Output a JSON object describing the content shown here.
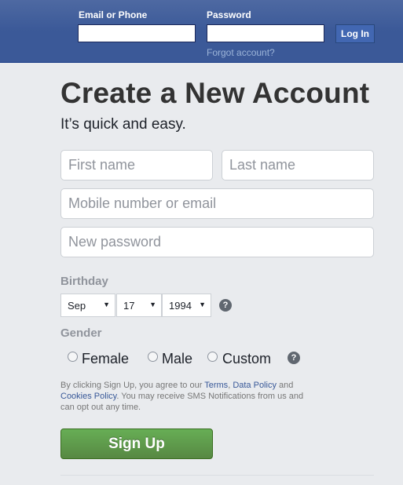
{
  "header": {
    "email_label": "Email or Phone",
    "password_label": "Password",
    "login_label": "Log In",
    "forgot_label": "Forgot account?"
  },
  "signup": {
    "title": "Create a New Account",
    "subtitle": "It’s quick and easy.",
    "first_name_placeholder": "First name",
    "last_name_placeholder": "Last name",
    "contact_placeholder": "Mobile number or email",
    "password_placeholder": "New password",
    "birthday_label": "Birthday",
    "birthday": {
      "month": "Sep",
      "day": "17",
      "year": "1994"
    },
    "gender_label": "Gender",
    "gender_options": [
      "Female",
      "Male",
      "Custom"
    ],
    "help_symbol": "?",
    "terms": {
      "t1": "By clicking Sign Up, you agree to our ",
      "terms_link": "Terms",
      "t2": ", ",
      "data_policy_link": "Data Policy",
      "t3": " and ",
      "cookies_link": "Cookies Policy",
      "t4": ". You may receive SMS Notifications from us and can opt out any time."
    },
    "signup_label": "Sign Up"
  },
  "colors": {
    "header_bg": "#3b5998",
    "signup_green": "#5fa048",
    "link_blue": "#385898"
  }
}
